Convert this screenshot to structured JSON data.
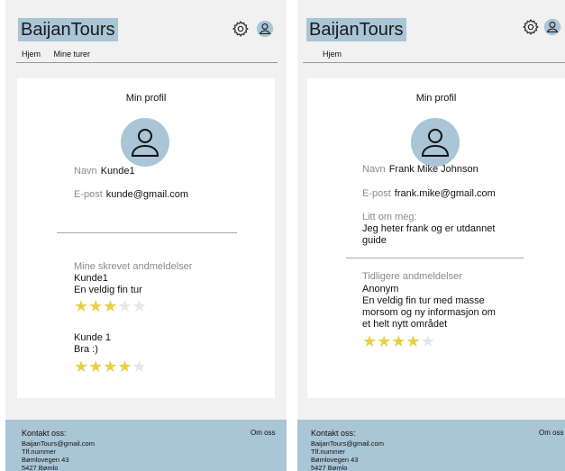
{
  "colors": {
    "accent": "#a9c5d6",
    "star": "#e8cf4a",
    "star_empty": "#e6e6e6",
    "panel_bg": "#f1f1f1"
  },
  "left": {
    "logo": "BaijanTours",
    "nav": [
      "Hjem",
      "Mine turer"
    ],
    "card_title": "Min profil",
    "name_label": "Navn",
    "name_value": "Kunde1",
    "email_label": "E-post",
    "email_value": "kunde@gmail.com",
    "reviews_heading": "Mine skrevet andmeldelser",
    "reviews": [
      {
        "author": "Kunde1",
        "text": "En veldig fin tur",
        "rating": 3,
        "max": 5
      },
      {
        "author": "Kunde 1",
        "text": "Bra :)",
        "rating": 4,
        "max": 5
      }
    ]
  },
  "right": {
    "logo": "BaijanTours",
    "nav": [
      "Hjem"
    ],
    "card_title": "Min profil",
    "name_label": "Navn",
    "name_value": "Frank Mike Johnson",
    "email_label": "E-post",
    "email_value": "frank.mike@gmail.com",
    "about_label": "Litt om meg:",
    "about_lines": [
      "Jeg heter frank og er utdannet",
      "guide"
    ],
    "reviews_heading": "Tidligere andmeldelser",
    "reviews": [
      {
        "author": "Anonym",
        "text_lines": [
          "En veldig fin tur med masse",
          "morsom og ny informasjon om",
          "et helt nytt området"
        ],
        "rating": 4,
        "max": 5
      }
    ]
  },
  "footer": {
    "title": "Kontakt oss:",
    "lines": [
      "BaijanTours@gmail.com",
      "Tlf.nummer",
      "Bømlovegen 43",
      "5427 Bømlo"
    ],
    "about_link": "Om oss"
  },
  "icons": {
    "settings": "gear-icon",
    "profile": "user-icon",
    "avatar": "user-icon"
  }
}
